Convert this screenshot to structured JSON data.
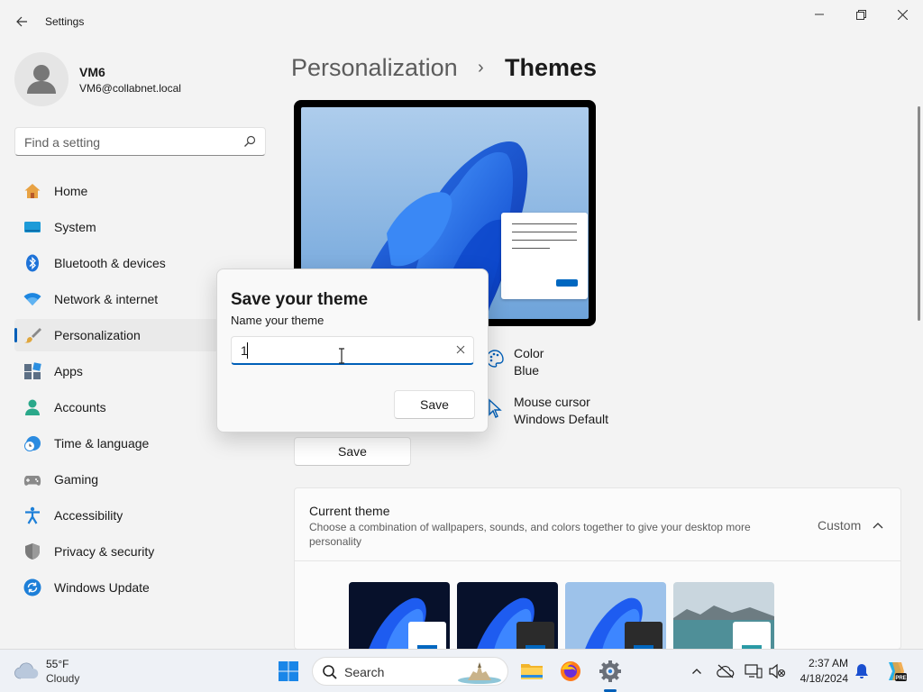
{
  "window": {
    "title": "Settings"
  },
  "user": {
    "name": "VM6",
    "email": "VM6@collabnet.local"
  },
  "search": {
    "placeholder": "Find a setting"
  },
  "nav": [
    {
      "label": "Home",
      "icon": "home-icon"
    },
    {
      "label": "System",
      "icon": "system-icon"
    },
    {
      "label": "Bluetooth & devices",
      "icon": "bluetooth-icon"
    },
    {
      "label": "Network & internet",
      "icon": "wifi-icon"
    },
    {
      "label": "Personalization",
      "icon": "brush-icon",
      "active": true
    },
    {
      "label": "Apps",
      "icon": "apps-icon"
    },
    {
      "label": "Accounts",
      "icon": "accounts-icon"
    },
    {
      "label": "Time & language",
      "icon": "clock-globe-icon"
    },
    {
      "label": "Gaming",
      "icon": "gamepad-icon"
    },
    {
      "label": "Accessibility",
      "icon": "accessibility-icon"
    },
    {
      "label": "Privacy & security",
      "icon": "shield-icon"
    },
    {
      "label": "Windows Update",
      "icon": "update-icon"
    }
  ],
  "breadcrumb": {
    "parent": "Personalization",
    "separator": "›",
    "current": "Themes"
  },
  "theme_props": {
    "color": {
      "title": "Color",
      "value": "Blue"
    },
    "cursor": {
      "title": "Mouse cursor",
      "value": "Windows Default"
    }
  },
  "save_button": "Save",
  "current_theme": {
    "title": "Current theme",
    "description": "Choose a combination of wallpapers, sounds, and colors together to give your desktop more personality",
    "value": "Custom"
  },
  "dialog": {
    "title": "Save your theme",
    "label": "Name your theme",
    "input_value": "1",
    "save_label": "Save"
  },
  "taskbar": {
    "weather": {
      "temp": "55°F",
      "condition": "Cloudy"
    },
    "search_label": "Search",
    "time": "2:37 AM",
    "date": "4/18/2024"
  },
  "colors": {
    "accent": "#005fb8",
    "wallpaper_blue": "#1a6ee0"
  }
}
